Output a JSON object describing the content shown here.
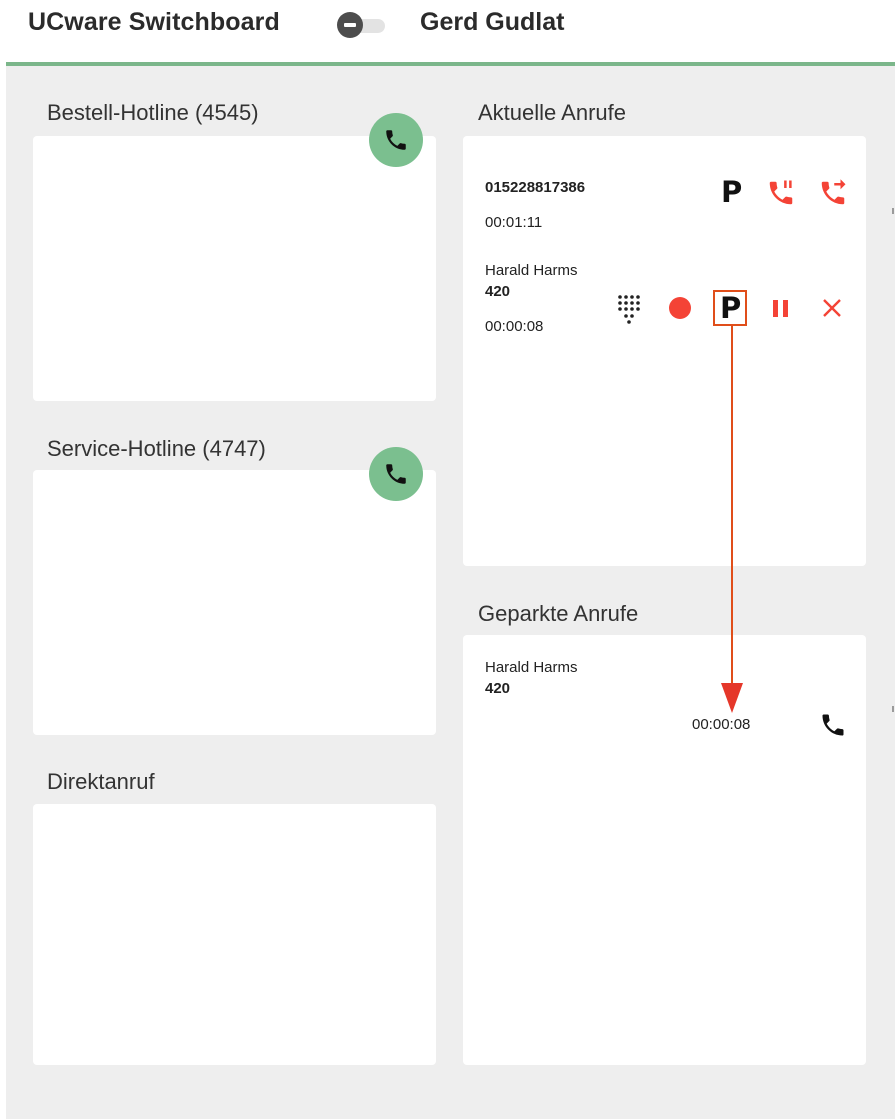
{
  "header": {
    "title": "UCware Switchboard",
    "user": "Gerd Gudlat"
  },
  "queues": [
    {
      "title": "Bestell-Hotline (4545)"
    },
    {
      "title": "Service-Hotline (4747)"
    },
    {
      "title": "Direktanruf"
    }
  ],
  "current_calls": {
    "title": "Aktuelle Anrufe",
    "calls": [
      {
        "number": "015228817386",
        "duration": "00:01:11"
      },
      {
        "name": "Harald Harms",
        "number": "420",
        "duration": "00:00:08"
      }
    ]
  },
  "parked_calls": {
    "title": "Geparkte Anrufe",
    "calls": [
      {
        "name": "Harald Harms",
        "number": "420",
        "duration": "00:00:08"
      }
    ]
  },
  "icons": {
    "park": "P",
    "accent_green": "#7bbf8f",
    "accent_red": "#f44336",
    "annotation_color": "#e04e1a"
  }
}
